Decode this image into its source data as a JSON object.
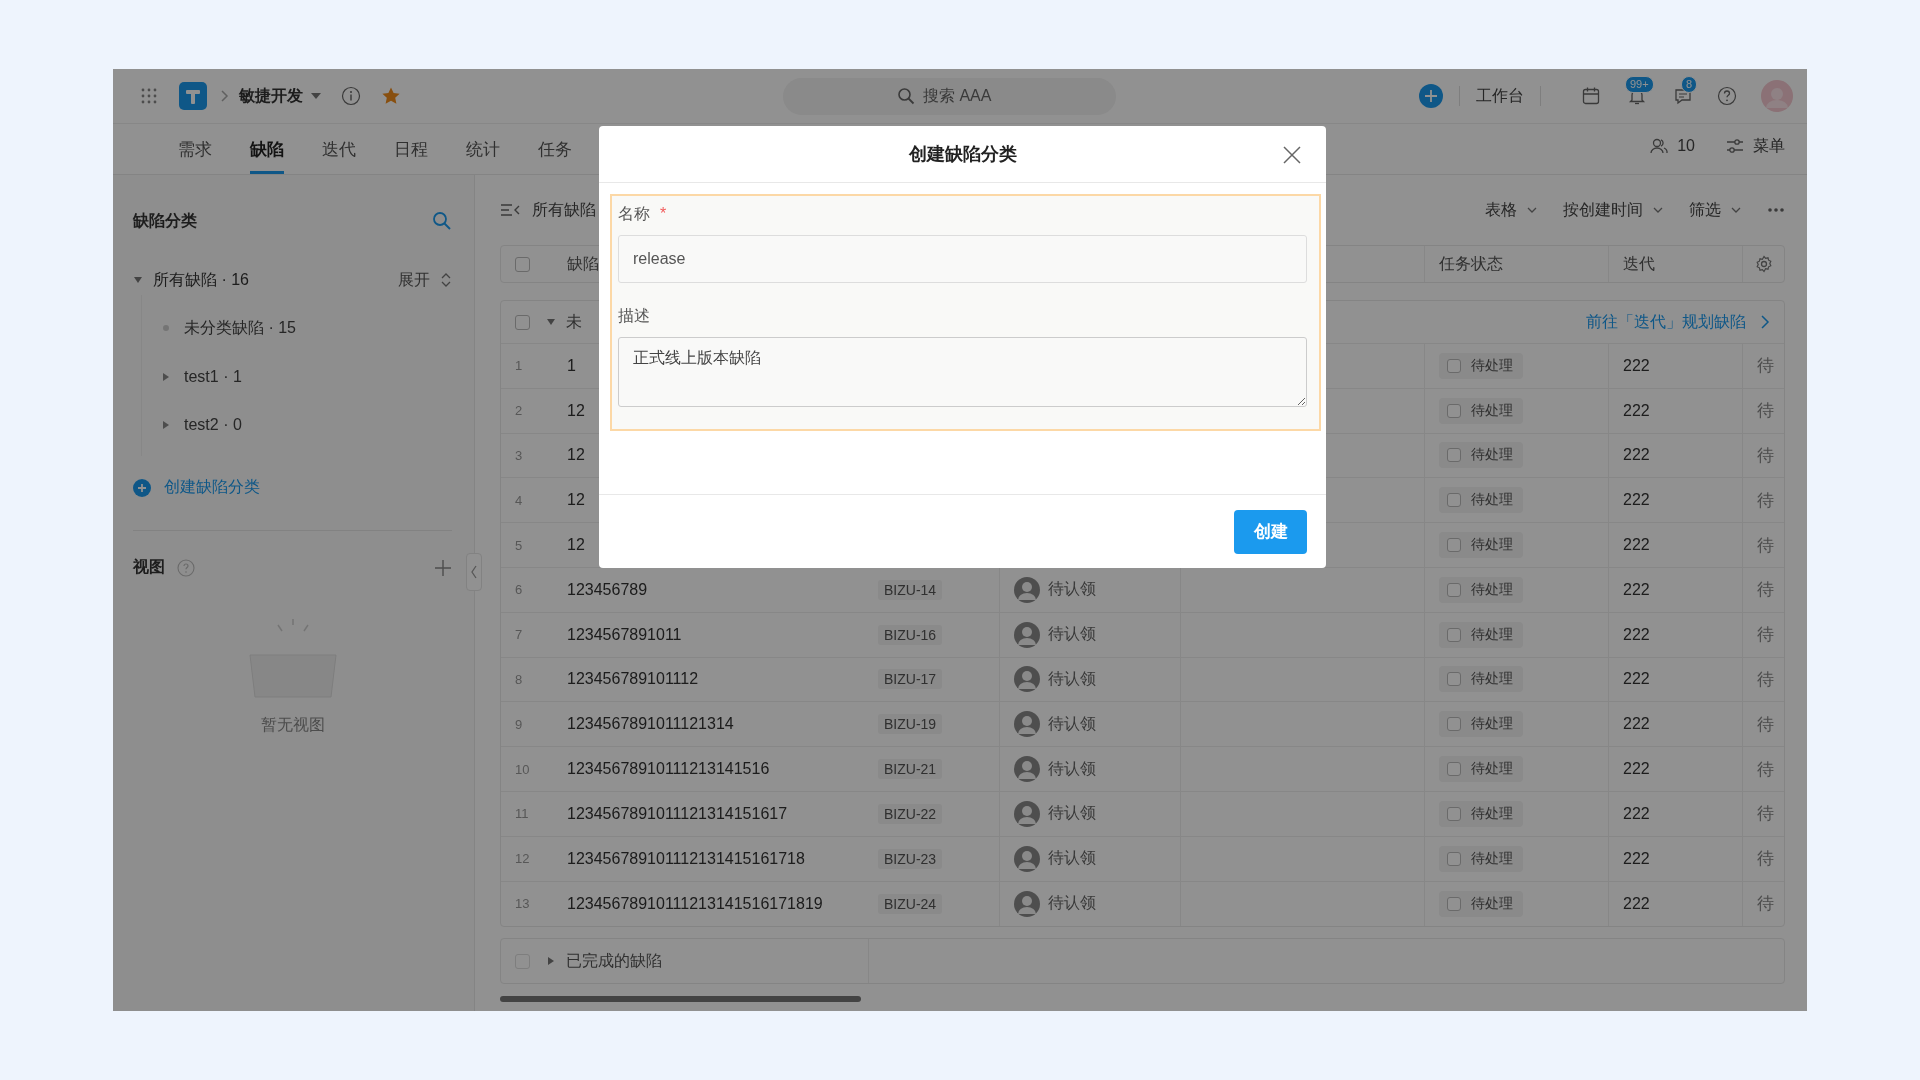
{
  "topbar": {
    "project": "敏捷开发",
    "search_placeholder": "搜索 AAA",
    "workbench": "工作台",
    "notification_badge": "99+",
    "message_badge": "8"
  },
  "tabs": [
    {
      "label": "需求",
      "selected": false
    },
    {
      "label": "缺陷",
      "selected": true
    },
    {
      "label": "迭代",
      "selected": false
    },
    {
      "label": "日程",
      "selected": false
    },
    {
      "label": "统计",
      "selected": false
    },
    {
      "label": "任务",
      "selected": false
    }
  ],
  "tab_actions": {
    "members": "10",
    "menu": "菜单"
  },
  "sidebar": {
    "title": "缺陷分类",
    "tree": {
      "label": "所有缺陷 · 16",
      "expanded": true,
      "action": "展开",
      "children": [
        {
          "label": "未分类缺陷 · 15",
          "kind": "leaf"
        },
        {
          "label": "test1 · 1",
          "kind": "branch"
        },
        {
          "label": "test2 · 0",
          "kind": "branch"
        }
      ]
    },
    "create": "创建缺陷分类",
    "views_title": "视图",
    "empty": "暂无视图"
  },
  "toolbar": {
    "title": "所有缺陷",
    "controls": [
      "表格",
      "按创建时间",
      "筛选"
    ]
  },
  "table": {
    "select_all_checked": false,
    "columns": [
      {
        "label": "缺陷"
      },
      {
        "label": "任务状态"
      },
      {
        "label": "迭代"
      }
    ],
    "group": {
      "label": "未",
      "checked": false,
      "expanded": true,
      "link": "前往「迭代」规划缺陷"
    },
    "rows": [
      {
        "index": "1",
        "title": "1",
        "status": "待处理",
        "checked": false,
        "iteration": "222",
        "column_8": "待"
      },
      {
        "index": "2",
        "title": "12",
        "status": "待处理",
        "checked": false,
        "iteration": "222",
        "column_8": "待"
      },
      {
        "index": "3",
        "title": "12",
        "status": "待处理",
        "checked": false,
        "iteration": "222",
        "column_8": "待"
      },
      {
        "index": "4",
        "title": "12",
        "status": "待处理",
        "checked": false,
        "iteration": "222",
        "column_8": "待"
      },
      {
        "index": "5",
        "title": "12",
        "status": "待处理",
        "checked": false,
        "iteration": "222",
        "column_8": "待"
      },
      {
        "index": "6",
        "title": "123456789",
        "id": "BIZU-14",
        "assignee": "待认领",
        "status": "待处理",
        "checked": false,
        "iteration": "222",
        "column_8": "待"
      },
      {
        "index": "7",
        "title": "1234567891011",
        "id": "BIZU-16",
        "assignee": "待认领",
        "status": "待处理",
        "checked": false,
        "iteration": "222",
        "column_8": "待"
      },
      {
        "index": "8",
        "title": "123456789101112",
        "id": "BIZU-17",
        "assignee": "待认领",
        "status": "待处理",
        "checked": false,
        "iteration": "222",
        "column_8": "待"
      },
      {
        "index": "9",
        "title": "1234567891011121314",
        "id": "BIZU-19",
        "assignee": "待认领",
        "status": "待处理",
        "checked": false,
        "iteration": "222",
        "column_8": "待"
      },
      {
        "index": "10",
        "title": "12345678910111213141516",
        "id": "BIZU-21",
        "assignee": "待认领",
        "status": "待处理",
        "checked": false,
        "iteration": "222",
        "column_8": "待"
      },
      {
        "index": "11",
        "title": "1234567891011121314151617",
        "id": "BIZU-22",
        "assignee": "待认领",
        "status": "待处理",
        "checked": false,
        "iteration": "222",
        "column_8": "待"
      },
      {
        "index": "12",
        "title": "123456789101112131415161718",
        "id": "BIZU-23",
        "assignee": "待认领",
        "status": "待处理",
        "checked": false,
        "iteration": "222",
        "column_8": "待"
      },
      {
        "index": "13",
        "title": "12345678910111213141516171819",
        "id": "BIZU-24",
        "assignee": "待认领",
        "status": "待处理",
        "checked": false,
        "iteration": "222",
        "column_8": "待"
      }
    ],
    "completed": {
      "label": "已完成的缺陷",
      "checked": false,
      "expanded": false
    }
  },
  "modal": {
    "title": "创建缺陷分类",
    "fields": [
      {
        "label": "名称",
        "required_mark": "*",
        "kind": "input",
        "value": "release"
      },
      {
        "label": "描述",
        "kind": "textarea",
        "value": "正式线上版本缺陷"
      }
    ],
    "button": "创建"
  }
}
